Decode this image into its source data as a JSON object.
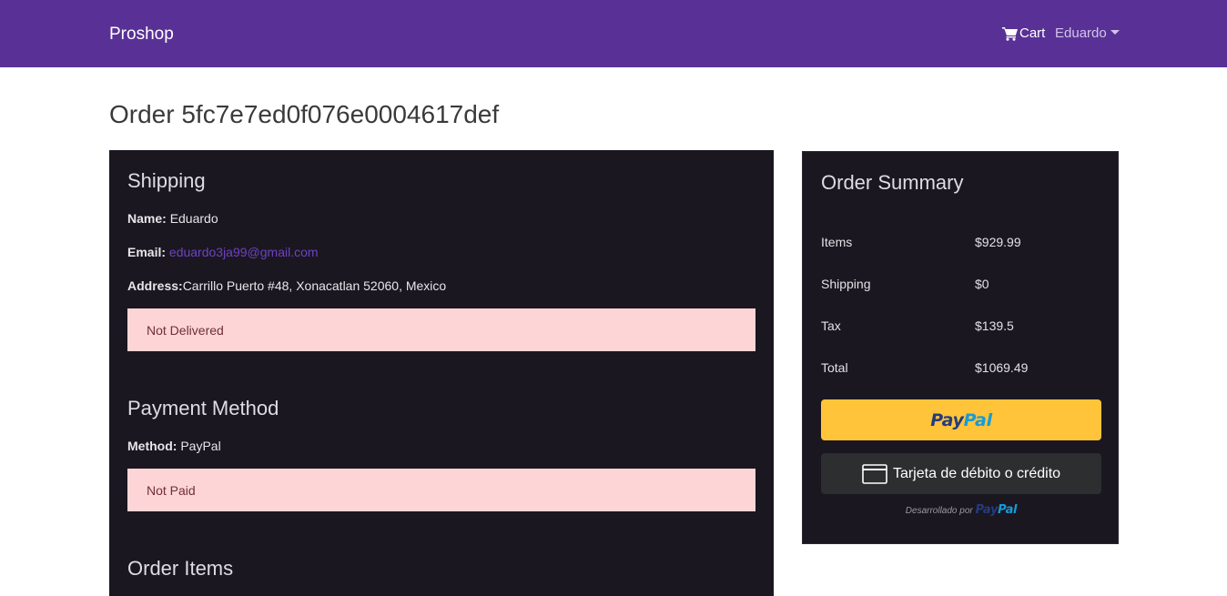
{
  "navbar": {
    "brand": "Proshop",
    "cart_label": "Cart",
    "user_label": "Eduardo"
  },
  "page": {
    "title": "Order 5fc7e7ed0f076e0004617def"
  },
  "shipping": {
    "heading": "Shipping",
    "name_label": "Name:",
    "name_value": "Eduardo",
    "email_label": "Email:",
    "email_value": "eduardo3ja99@gmail.com",
    "address_label": "Address:",
    "address_value": "Carrillo Puerto #48, Xonacatlan 52060, Mexico",
    "status": "Not Delivered"
  },
  "payment": {
    "heading": "Payment Method",
    "method_label": "Method:",
    "method_value": "PayPal",
    "status": "Not Paid"
  },
  "order_items": {
    "heading": "Order Items"
  },
  "summary": {
    "heading": "Order Summary",
    "rows": [
      {
        "label": "Items",
        "value": "$929.99"
      },
      {
        "label": "Shipping",
        "value": "$0"
      },
      {
        "label": "Tax",
        "value": "$139.5"
      },
      {
        "label": "Total",
        "value": "$1069.49"
      }
    ],
    "paypal_a": "Pay",
    "paypal_b": "Pal",
    "card_button": "Tarjeta de débito o crédito",
    "powered_by": "Desarrollado por"
  },
  "colors": {
    "navbar": "#593196",
    "panel": "#1a1720",
    "alert_bg": "#fdd5d7",
    "paypal_yellow": "#ffc439"
  }
}
